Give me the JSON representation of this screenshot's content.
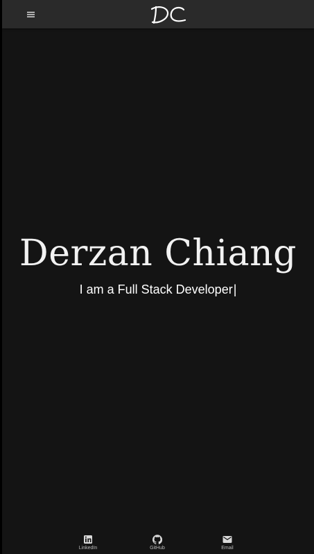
{
  "header": {
    "logo_text": "DC",
    "menu_icon": "hamburger-menu-icon"
  },
  "hero": {
    "name": "Derzan Chiang",
    "tagline": "I am a Full Stack Developer",
    "cursor": "|"
  },
  "bottom_nav": [
    {
      "label": "LinkedIn",
      "icon": "linkedin-icon"
    },
    {
      "label": "GitHub",
      "icon": "github-icon"
    },
    {
      "label": "Email",
      "icon": "email-icon"
    }
  ],
  "colors": {
    "background": "#141414",
    "topbar": "#2a2a2a",
    "text": "#ffffff",
    "nav_label": "#bdbdbd"
  }
}
